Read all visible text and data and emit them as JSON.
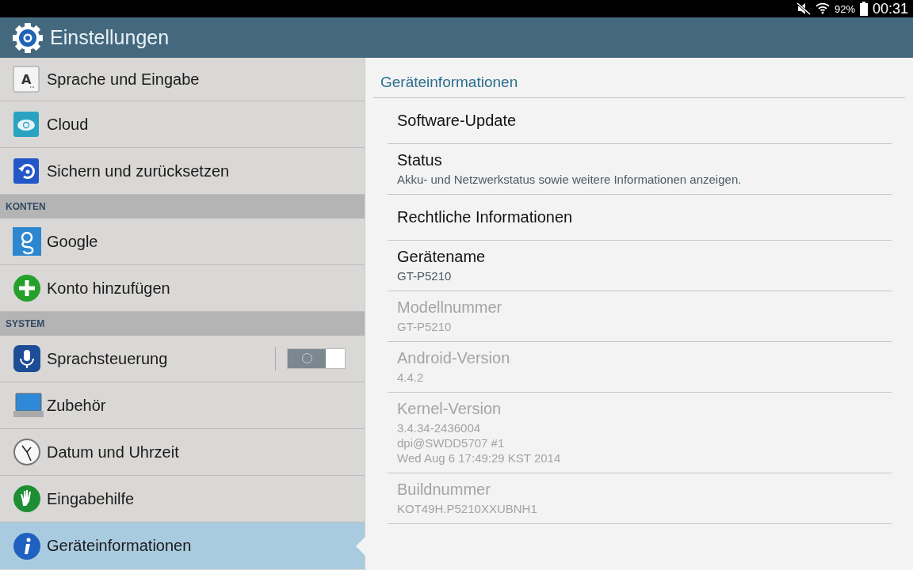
{
  "status_bar": {
    "battery": "92%",
    "time": "00:31"
  },
  "app_bar": {
    "title": "Einstellungen"
  },
  "sidebar": {
    "items": [
      {
        "kind": "item",
        "label": "Sprache und Eingabe",
        "selected": false,
        "icon_text": "A"
      },
      {
        "kind": "item",
        "label": "Cloud",
        "selected": false
      },
      {
        "kind": "item",
        "label": "Sichern und zurücksetzen",
        "selected": false
      },
      {
        "kind": "header",
        "label": "KONTEN"
      },
      {
        "kind": "item",
        "label": "Google",
        "selected": false
      },
      {
        "kind": "item",
        "label": "Konto hinzufügen",
        "selected": false
      },
      {
        "kind": "header",
        "label": "SYSTEM"
      },
      {
        "kind": "item",
        "label": "Sprachsteuerung",
        "selected": false,
        "switch": {
          "on": false
        }
      },
      {
        "kind": "item",
        "label": "Zubehör",
        "selected": false
      },
      {
        "kind": "item",
        "label": "Datum und Uhrzeit",
        "selected": false
      },
      {
        "kind": "item",
        "label": "Eingabehilfe",
        "selected": false
      },
      {
        "kind": "item",
        "label": "Geräteinformationen",
        "selected": true
      }
    ]
  },
  "detail": {
    "title": "Geräteinformationen",
    "items": [
      {
        "title": "Software-Update",
        "disabled": false
      },
      {
        "title": "Status",
        "summary": "Akku- und Netzwerkstatus sowie weitere Informationen anzeigen.",
        "disabled": false
      },
      {
        "title": "Rechtliche Informationen",
        "disabled": false
      },
      {
        "title": "Gerätename",
        "summary": "GT-P5210",
        "disabled": false
      },
      {
        "title": "Modellnummer",
        "summary": "GT-P5210",
        "disabled": true
      },
      {
        "title": "Android-Version",
        "summary": "4.4.2",
        "disabled": true
      },
      {
        "title": "Kernel-Version",
        "summary": "3.4.34-2436004\ndpi@SWDD5707 #1\nWed Aug 6 17:49:29 KST 2014",
        "disabled": true
      },
      {
        "title": "Buildnummer",
        "summary": "KOT49H.P5210XXUBNH1",
        "disabled": true
      }
    ]
  }
}
